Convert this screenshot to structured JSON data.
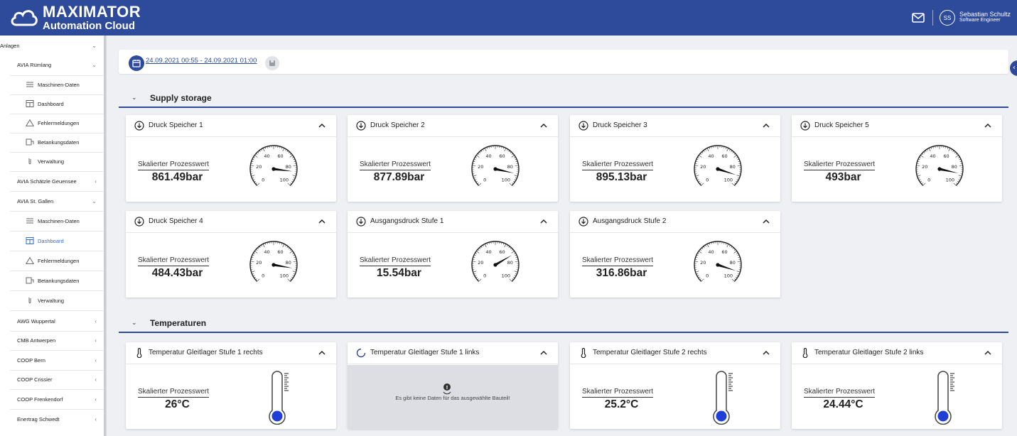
{
  "header": {
    "brand_title": "MAXIMATOR",
    "brand_subtitle": "Automation Cloud",
    "user_initials": "SS",
    "user_name": "Sebastian Schultz",
    "user_role": "Software Engineer",
    "color": "#2e4a9a"
  },
  "sidebar": {
    "root": "Anlagen",
    "items": [
      {
        "label": "AVIA Rümlang"
      },
      {
        "label": "Maschinen-Daten"
      },
      {
        "label": "Dashboard"
      },
      {
        "label": "Fehlermeldungen"
      },
      {
        "label": "Betankungsdaten"
      },
      {
        "label": "Verwaltung"
      },
      {
        "label": "AVIA Schätzle Geuensee"
      },
      {
        "label": "AVIA St. Gallen"
      },
      {
        "label": "Maschinen-Daten"
      },
      {
        "label": "Dashboard"
      },
      {
        "label": "Fehlermeldungen"
      },
      {
        "label": "Betankungsdaten"
      },
      {
        "label": "Verwaltung"
      },
      {
        "label": "AWG Wuppertal"
      },
      {
        "label": "CMB Antwerpen"
      },
      {
        "label": "COOP Bern"
      },
      {
        "label": "COOP Crissier"
      },
      {
        "label": "COOP Frenkendorf"
      },
      {
        "label": "Enertrag Schwedt"
      }
    ],
    "active_color": "#2e6fd0"
  },
  "date_range": "24.09.2021 00:55 - 24.09.2021 01:00",
  "sections": {
    "supply": "Supply storage",
    "temps": "Temperaturen"
  },
  "pressure_cards": [
    {
      "title": "Druck Speicher 1",
      "label": "Skalierter Prozesswert",
      "value": "861.49bar",
      "needle": 86
    },
    {
      "title": "Druck Speicher 2",
      "label": "Skalierter Prozesswert",
      "value": "877.89bar",
      "needle": 88
    },
    {
      "title": "Druck Speicher 3",
      "label": "Skalierter Prozesswert",
      "value": "895.13bar",
      "needle": 90
    },
    {
      "title": "Druck Speicher 5",
      "label": "Skalierter Prozesswert",
      "value": "493bar",
      "needle": 88
    },
    {
      "title": "Druck Speicher 4",
      "label": "Skalierter Prozesswert",
      "value": "484.43bar",
      "needle": 87
    },
    {
      "title": "Ausgangsdruck Stufe 1",
      "label": "Skalierter Prozesswert",
      "value": "15.54bar",
      "needle": 72
    },
    {
      "title": "Ausgangsdruck Stufe 2",
      "label": "Skalierter Prozesswert",
      "value": "316.86bar",
      "needle": 90
    }
  ],
  "temp_cards": [
    {
      "title": "Temperatur Gleitlager Stufe 1 rechts",
      "label": "Skalierter Prozesswert",
      "value": "26°C"
    },
    {
      "title": "Temperatur Gleitlager Stufe 1 links",
      "empty_message": "Es gibt keine Daten für das ausgewählte Bauteil!"
    },
    {
      "title": "Temperatur Gleitlager Stufe 2 rechts",
      "label": "Skalierter Prozesswert",
      "value": "25.2°C"
    },
    {
      "title": "Temperatur Gleitlager Stufe 2 links",
      "label": "Skalierter Prozesswert",
      "value": "24.44°C"
    }
  ],
  "gauge_ticks": [
    "0",
    "20",
    "40",
    "60",
    "80",
    "100"
  ]
}
